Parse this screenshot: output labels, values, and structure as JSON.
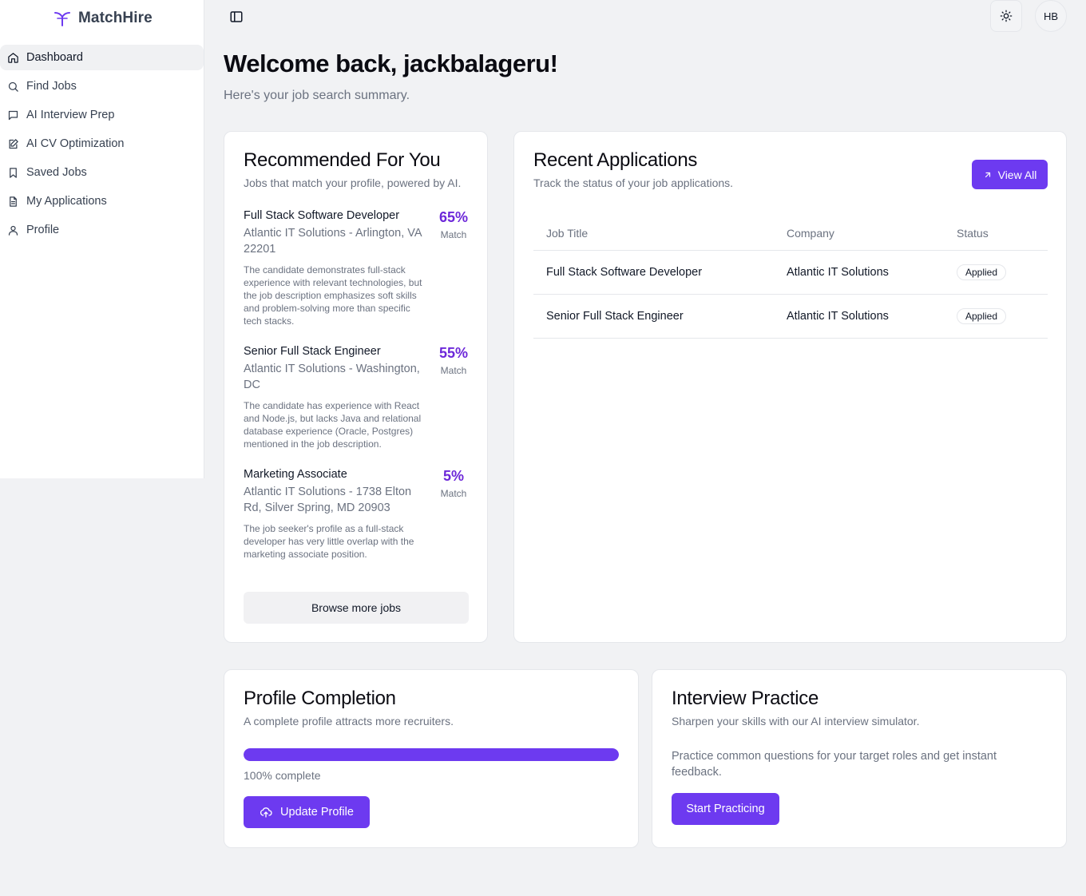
{
  "brand": {
    "name": "MatchHire",
    "accent": "#6d3af0"
  },
  "sidebar": {
    "items": [
      {
        "label": "Dashboard",
        "icon": "home-icon",
        "active": true
      },
      {
        "label": "Find Jobs",
        "icon": "search-icon"
      },
      {
        "label": "AI Interview Prep",
        "icon": "message-square-icon"
      },
      {
        "label": "AI CV Optimization",
        "icon": "edit-document-icon"
      },
      {
        "label": "Saved Jobs",
        "icon": "bookmark-icon"
      },
      {
        "label": "My Applications",
        "icon": "file-text-icon"
      },
      {
        "label": "Profile",
        "icon": "user-icon"
      }
    ]
  },
  "topbar": {
    "avatar_initials": "HB",
    "toggle_icon": "sidebar-toggle-icon",
    "theme_icon": "sun-icon"
  },
  "header": {
    "title": "Welcome back, jackbalageru!",
    "subtitle": "Here's your job search summary."
  },
  "recommended": {
    "title": "Recommended For You",
    "description": "Jobs that match your profile, powered by AI.",
    "jobs": [
      {
        "title": "Full Stack Software Developer",
        "location": "Atlantic IT Solutions - Arlington, VA 22201",
        "reason": "The candidate demonstrates full-stack experience with relevant technologies, but the job description emphasizes soft skills and problem-solving more than specific tech stacks.",
        "match_pct": "65%",
        "match_label": "Match"
      },
      {
        "title": "Senior Full Stack Engineer",
        "location": "Atlantic IT Solutions - Washington, DC",
        "reason": "The candidate has experience with React and Node.js, but lacks Java and relational database experience (Oracle, Postgres) mentioned in the job description.",
        "match_pct": "55%",
        "match_label": "Match"
      },
      {
        "title": "Marketing Associate",
        "location": "Atlantic IT Solutions - 1738 Elton Rd, Silver Spring, MD 20903",
        "reason": "The job seeker's profile as a full-stack developer has very little overlap with the marketing associate position.",
        "match_pct": "5%",
        "match_label": "Match"
      }
    ],
    "browse_label": "Browse more jobs"
  },
  "applications": {
    "title": "Recent Applications",
    "description": "Track the status of your job applications.",
    "view_all_label": "View All",
    "columns": [
      "Job Title",
      "Company",
      "Status"
    ],
    "rows": [
      {
        "job_title": "Full Stack Software Developer",
        "company": "Atlantic IT Solutions",
        "status": "Applied"
      },
      {
        "job_title": "Senior Full Stack Engineer",
        "company": "Atlantic IT Solutions",
        "status": "Applied"
      }
    ]
  },
  "profile_completion": {
    "title": "Profile Completion",
    "description": "A complete profile attracts more recruiters.",
    "progress": 1.0,
    "progress_text": "100% complete",
    "button_label": "Update Profile"
  },
  "interview_practice": {
    "title": "Interview Practice",
    "description": "Sharpen your skills with our AI interview simulator.",
    "body": "Practice common questions for your target roles and get instant feedback.",
    "button_label": "Start Practicing"
  }
}
